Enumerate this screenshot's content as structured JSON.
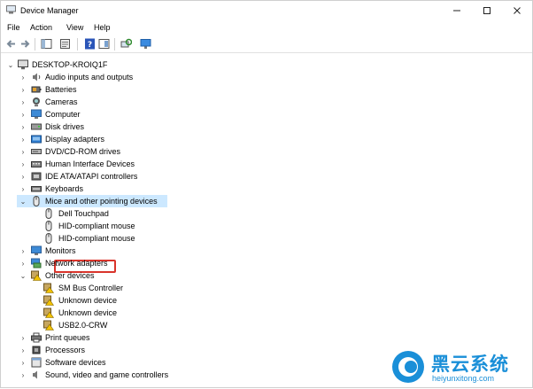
{
  "window": {
    "title": "Device Manager"
  },
  "menu": [
    "File",
    "Action",
    "View",
    "Help"
  ],
  "tree": {
    "root": "DESKTOP-KROIQ1F",
    "categories": [
      {
        "label": "Audio inputs and outputs",
        "icon": "speaker-icon"
      },
      {
        "label": "Batteries",
        "icon": "battery-icon"
      },
      {
        "label": "Cameras",
        "icon": "camera-icon"
      },
      {
        "label": "Computer",
        "icon": "monitor-icon"
      },
      {
        "label": "Disk drives",
        "icon": "disk-icon"
      },
      {
        "label": "Display adapters",
        "icon": "display-adapter-icon"
      },
      {
        "label": "DVD/CD-ROM drives",
        "icon": "dvd-icon"
      },
      {
        "label": "Human Interface Devices",
        "icon": "hid-icon"
      },
      {
        "label": "IDE ATA/ATAPI controllers",
        "icon": "ide-icon"
      },
      {
        "label": "Keyboards",
        "icon": "keyboard-icon"
      }
    ],
    "mice": {
      "label": "Mice and other pointing devices",
      "children": [
        "Dell Touchpad",
        "HID-compliant mouse",
        "HID-compliant mouse"
      ]
    },
    "more_categories": [
      {
        "label": "Monitors",
        "icon": "monitor-icon"
      },
      {
        "label": "Network adapters",
        "icon": "network-icon"
      }
    ],
    "other": {
      "label": "Other devices",
      "children": [
        "SM Bus Controller",
        "Unknown device",
        "Unknown device",
        "USB2.0-CRW"
      ]
    },
    "tail_categories": [
      {
        "label": "Print queues",
        "icon": "printer-icon"
      },
      {
        "label": "Processors",
        "icon": "cpu-icon"
      },
      {
        "label": "Software devices",
        "icon": "software-icon"
      },
      {
        "label": "Sound, video and game controllers",
        "icon": "sound-icon"
      }
    ]
  },
  "watermark": {
    "brand": "黑云系统",
    "url": "heiyunxitong.com"
  },
  "colors": {
    "selection": "#cce8ff",
    "highlight_box": "#d9342b",
    "watermark_blue": "#1a8fd8"
  }
}
